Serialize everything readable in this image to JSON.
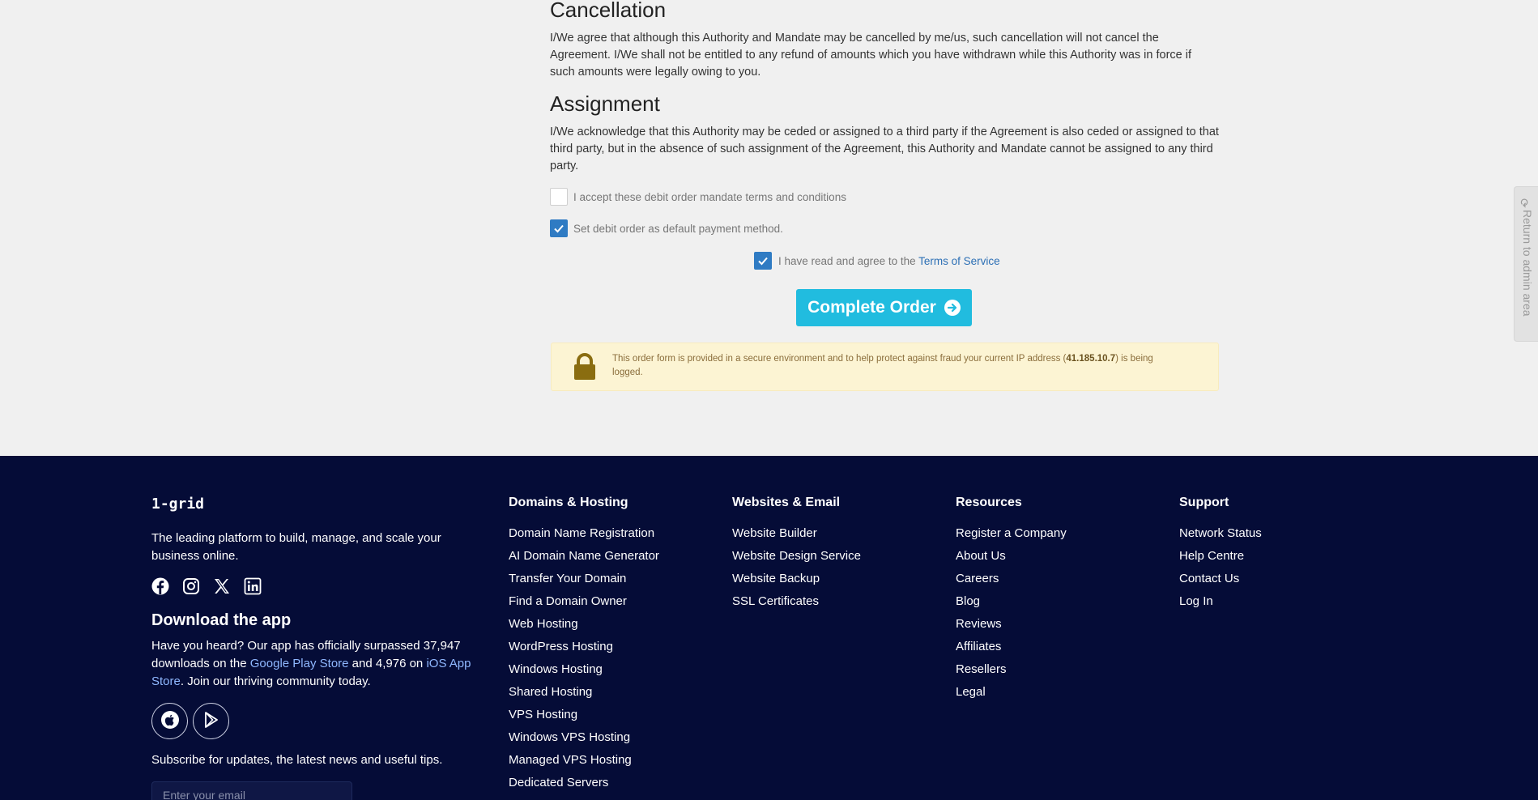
{
  "cancellation": {
    "heading": "Cancellation",
    "text": "I/We agree that although this Authority and Mandate may be cancelled by me/us, such cancellation will not cancel the Agreement. I/We shall not be entitled to any refund of amounts which you have withdrawn while this Authority was in force if such amounts were legally owing to you."
  },
  "assignment": {
    "heading": "Assignment",
    "text": "I/We acknowledge that this Authority may be ceded or assigned to a third party if the Agreement is also ceded or assigned to that third party, but in the absence of such assignment of the Agreement, this Authority and Mandate cannot be assigned to any third party."
  },
  "checkboxes": {
    "accept_label": "I accept these debit order mandate terms and conditions",
    "accept_checked": false,
    "default_label": "Set debit order as default payment method.",
    "default_checked": true,
    "tos_prefix": "I have read and agree to the",
    "tos_link": "Terms of Service",
    "tos_checked": true
  },
  "complete_button": "Complete Order",
  "secure_notice": {
    "text_before": "This order form is provided in a secure environment and to help protect against fraud your current IP address (",
    "ip": "41.185.10.7",
    "text_after": ") is being logged."
  },
  "admin_tab": "Return to admin area",
  "footer": {
    "brand": "1-grid",
    "tagline": "The leading platform to build, manage, and scale your business online.",
    "social_icons": [
      "facebook-icon",
      "instagram-icon",
      "x-icon",
      "linkedin-icon"
    ],
    "app": {
      "title": "Download the app",
      "text_1": "Have you heard? Our app has officially surpassed 37,947 downloads on the ",
      "play_link": "Google Play Store",
      "text_2": " and 4,976 on ",
      "ios_link": "iOS App Store",
      "text_3": ". Join our thriving community today."
    },
    "subscribe_text": "Subscribe for updates, the latest news and useful tips.",
    "email_placeholder": "Enter your email",
    "columns": [
      {
        "title": "Domains & Hosting",
        "links": [
          "Domain Name Registration",
          "AI Domain Name Generator",
          "Transfer Your Domain",
          "Find a Domain Owner",
          "Web Hosting",
          "WordPress Hosting",
          "Windows Hosting",
          "Shared Hosting",
          "VPS Hosting",
          "Windows VPS Hosting",
          "Managed VPS Hosting",
          "Dedicated Servers"
        ]
      },
      {
        "title": "Websites & Email",
        "links": [
          "Website Builder",
          "Website Design Service",
          "Website Backup",
          "SSL Certificates"
        ]
      },
      {
        "title": "Resources",
        "links": [
          "Register a Company",
          "About Us",
          "Careers",
          "Blog",
          "Reviews",
          "Affiliates",
          "Resellers",
          "Legal"
        ]
      },
      {
        "title": "Support",
        "links": [
          "Network Status",
          "Help Centre",
          "Contact Us",
          "Log In"
        ]
      }
    ]
  }
}
